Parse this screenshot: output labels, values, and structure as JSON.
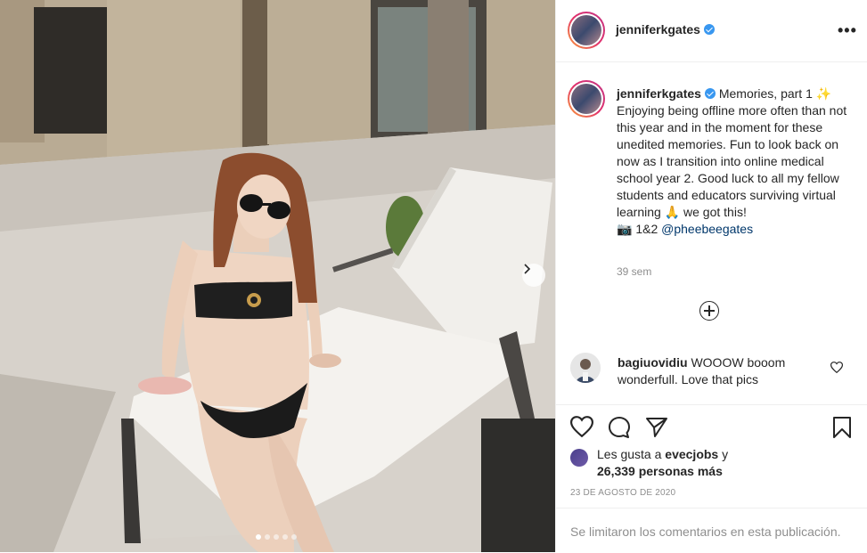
{
  "photo": {
    "alt_icon": "photo",
    "carousel": {
      "count": 5,
      "active": 0
    }
  },
  "header": {
    "username": "jenniferkgates",
    "more_icon": "more-horizontal-icon",
    "more_glyph": "•••"
  },
  "caption": {
    "username": "jenniferkgates",
    "text": "Memories, part 1 ✨ Enjoying being offline more often than not this year and in the moment for these unedited memories. Fun to look back on now as I transition into online medical school year 2. Good luck to all my fellow students and educators surviving virtual learning 🙏 we got this!",
    "credit_prefix": "📷 1&2 ",
    "credit_mention": "@pheebeegates",
    "time": "39 sem"
  },
  "comment": {
    "username": "bagiuovidiu",
    "text": "WOOOW booom wonderfull. Love that pics"
  },
  "likes": {
    "prefix": "Les gusta a ",
    "user": "evecjobs",
    "middle": " y ",
    "count": "26,339 personas más"
  },
  "date": "23 DE AGOSTO DE 2020",
  "footer": "Se limitaron los comentarios en esta publicación.",
  "colors": {
    "link": "#00376b",
    "verified": "#3897f0",
    "muted": "#8e8e8e"
  }
}
